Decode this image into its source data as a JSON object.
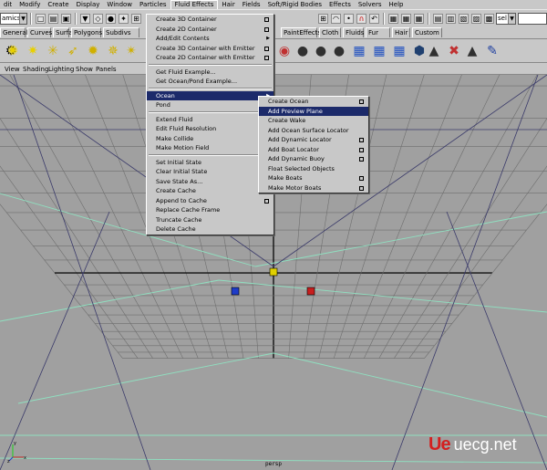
{
  "menubar": [
    "dit",
    "Modify",
    "Create",
    "Display",
    "Window",
    "Particles",
    "Fluid Effects",
    "Hair",
    "Fields",
    "Soft/Rigid Bodies",
    "Effects",
    "Solvers",
    "Help"
  ],
  "status": {
    "mode_value": "amics",
    "select_value": "sel"
  },
  "shelf_tabs": [
    "General",
    "Curves",
    "Surfaces",
    "Polygons",
    "Subdivs",
    "PaintEffects",
    "Cloth",
    "Fluids",
    "Fur",
    "Hair",
    "Custom"
  ],
  "panel_menus": [
    "View",
    "Shading",
    "Lighting",
    "Show",
    "Panels"
  ],
  "fluid_menu": {
    "items": [
      "Create 3D Container",
      "Create 2D Container",
      "Add/Edit Contents",
      "Create 3D Container with Emitter",
      "Create 2D Container with Emitter",
      "Get Fluid Example...",
      "Get Ocean/Pond Example...",
      "Ocean",
      "Pond",
      "Extend Fluid",
      "Edit Fluid Resolution",
      "Make Collide",
      "Make Motion Field",
      "Set Initial State",
      "Clear Initial State",
      "Save State As...",
      "Create Cache",
      "Append to Cache",
      "Replace Cache Frame",
      "Truncate Cache",
      "Delete Cache"
    ]
  },
  "ocean_menu": {
    "items": [
      "Create Ocean",
      "Add Preview Plane",
      "Create Wake",
      "Add Ocean Surface Locator",
      "Add Dynamic Locator",
      "Add Boat Locator",
      "Add Dynamic Buoy",
      "Float Selected Objects",
      "Make Boats",
      "Make Motor Boats"
    ]
  },
  "viewport": {
    "camera_label": "persp"
  },
  "icons": [
    "new-scene-icon",
    "open-scene-icon",
    "save-scene-icon",
    "select-icon",
    "lasso-icon",
    "paint-select-icon",
    "move-icon",
    "snap-icon",
    "magnet-icon",
    "history-icon",
    "render-icon",
    "ipr-icon",
    "render-settings-icon",
    "particle-tool-icon",
    "emitter-icon",
    "light-icon",
    "fire-icon",
    "shatter-icon",
    "hypershade-icon"
  ],
  "colors": {
    "menu_highlight": "#1c2a6a",
    "grid": "#6e6e6e",
    "grid_axis": "#101010",
    "container_lines": "#3a3a6a",
    "floor": "#8fe0c0",
    "watermark_red": "#d32020"
  },
  "watermark": {
    "logo": "Ue",
    "text": "uecg.net"
  }
}
